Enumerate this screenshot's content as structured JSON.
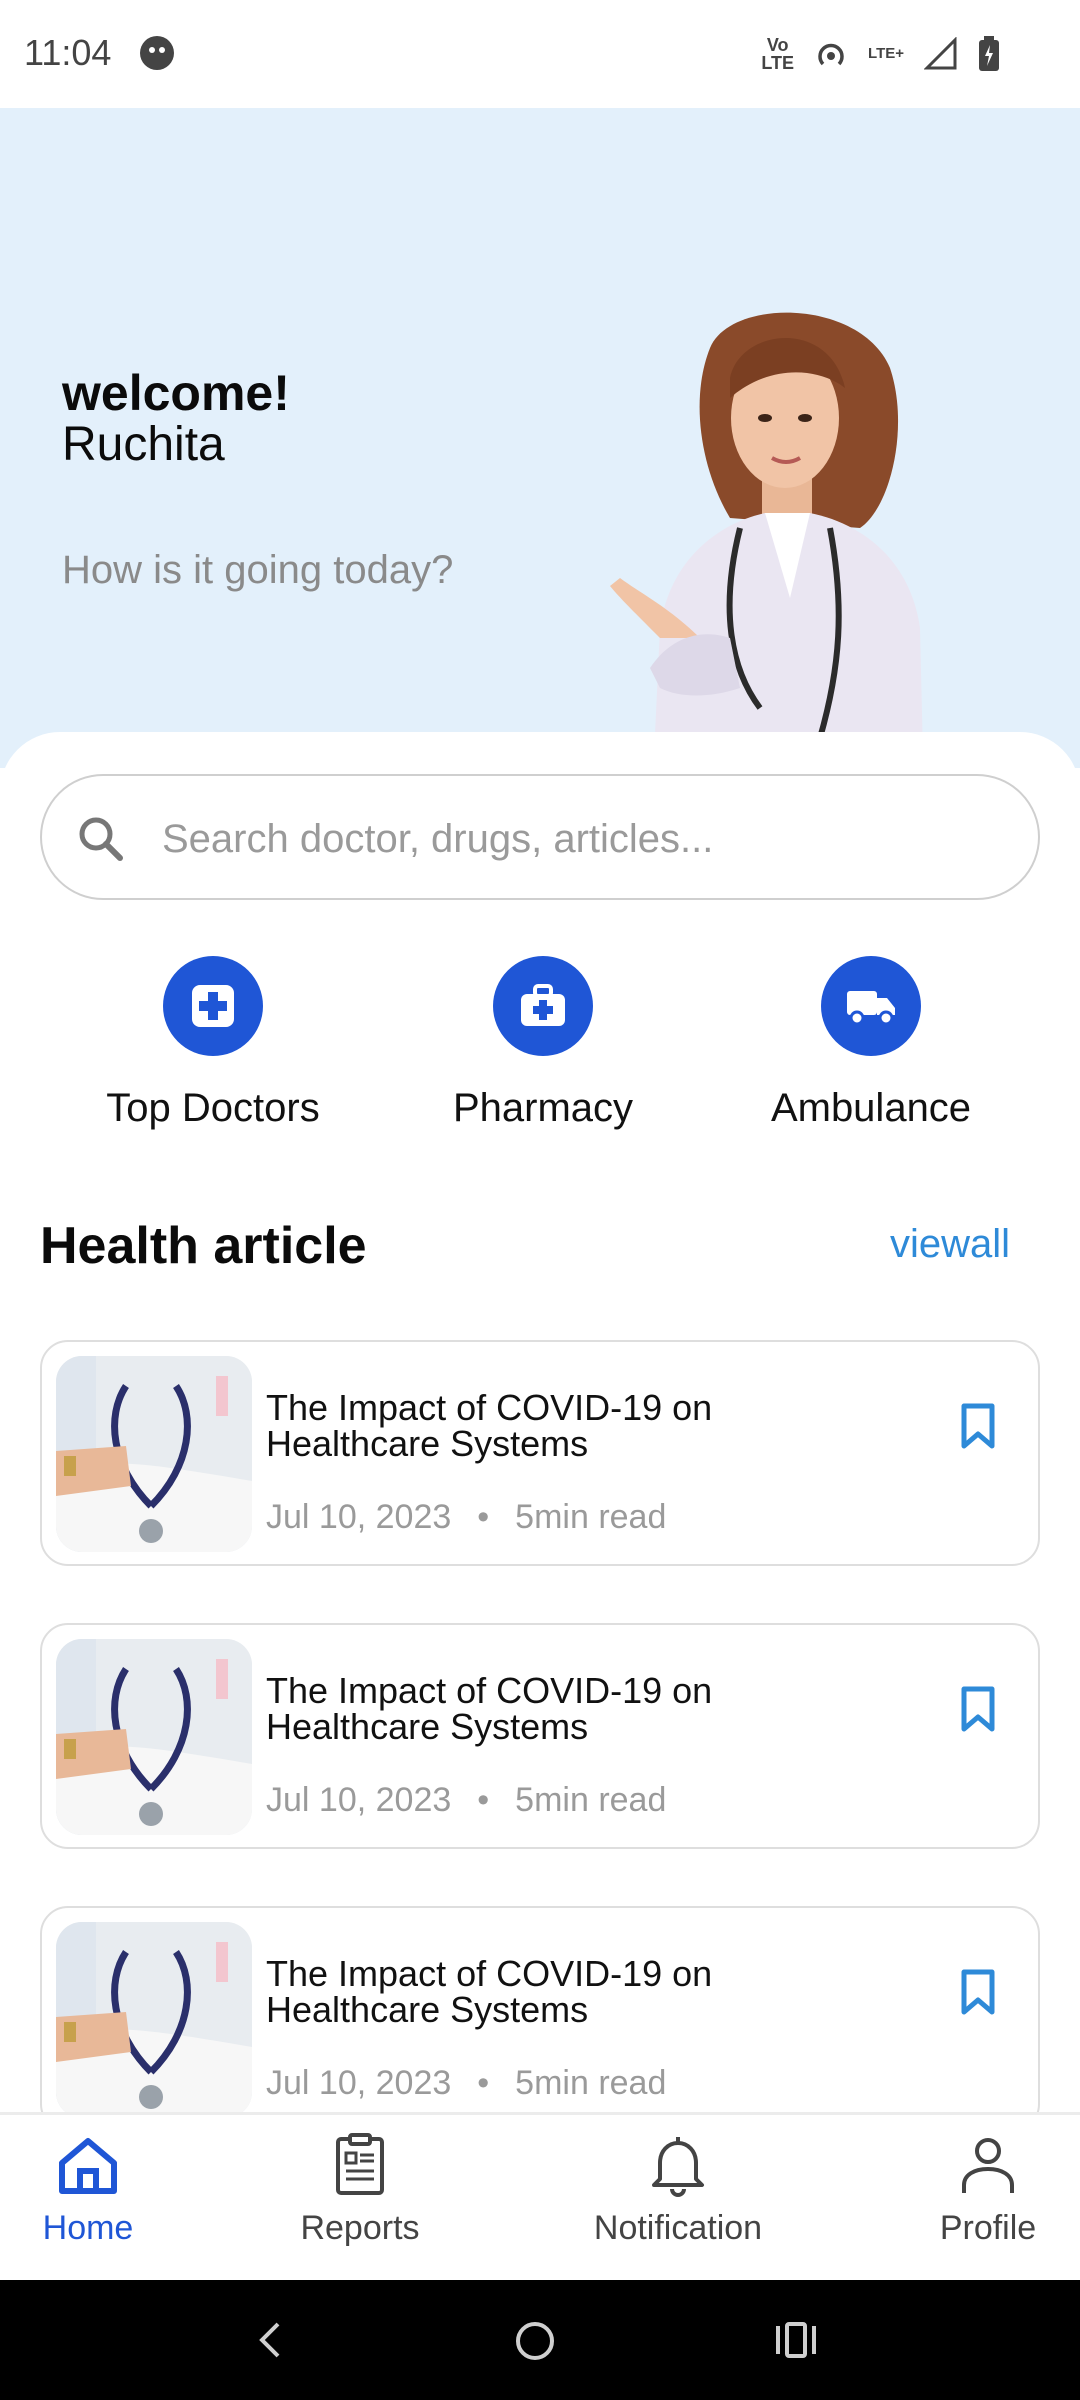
{
  "status_bar": {
    "time": "11:04",
    "volte_top": "Vo",
    "volte_bottom": "LTE",
    "lte_plus": "LTE+"
  },
  "hero": {
    "welcome": "welcome!",
    "username": "Ruchita",
    "subtitle": "How is it going today?"
  },
  "search": {
    "placeholder": "Search doctor, drugs, articles..."
  },
  "quick_actions": [
    {
      "label": "Top Doctors",
      "icon": "medical-cross-icon"
    },
    {
      "label": "Pharmacy",
      "icon": "medical-kit-icon"
    },
    {
      "label": "Ambulance",
      "icon": "ambulance-truck-icon"
    }
  ],
  "health_article": {
    "title": "Health article",
    "viewall": "viewall",
    "articles": [
      {
        "title": "The Impact of COVID-19 on Healthcare Systems",
        "date": "Jul 10, 2023",
        "dot": "•",
        "read_time": "5min read"
      },
      {
        "title": "The Impact of COVID-19 on Healthcare Systems",
        "date": "Jul 10, 2023",
        "dot": "•",
        "read_time": "5min read"
      },
      {
        "title": "The Impact of COVID-19 on Healthcare Systems",
        "date": "Jul 10, 2023",
        "dot": "•",
        "read_time": "5min read"
      }
    ]
  },
  "bottom_nav": [
    {
      "label": "Home",
      "icon": "home-icon",
      "active": true
    },
    {
      "label": "Reports",
      "icon": "reports-icon",
      "active": false
    },
    {
      "label": "Notification",
      "icon": "bell-icon",
      "active": false
    },
    {
      "label": "Profile",
      "icon": "person-icon",
      "active": false
    }
  ],
  "colors": {
    "accent": "#1f56d6",
    "link": "#2e8ad8",
    "hero_background": "#e3f0fb"
  }
}
